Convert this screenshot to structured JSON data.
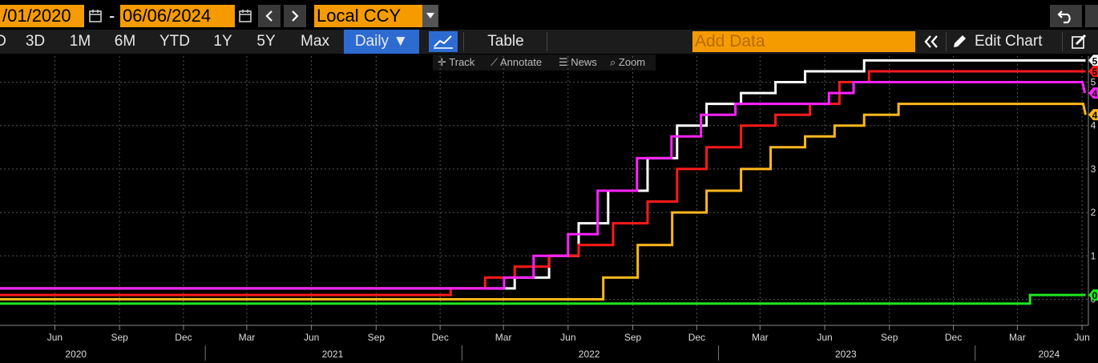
{
  "toolbar": {
    "start_date": "/01/2020",
    "end_date": "06/06/2024",
    "date_sep": "-",
    "currency": "Local CCY",
    "ranges": [
      "D",
      "3D",
      "1M",
      "6M",
      "YTD",
      "1Y",
      "5Y",
      "Max"
    ],
    "frequency": "Daily ▼",
    "table_label": "Table",
    "add_data_placeholder": "Add Data",
    "edit_chart_label": "Edit Chart",
    "undo_icon": "undo-icon"
  },
  "chart_tools": {
    "track": "Track",
    "annotate": "Annotate",
    "news": "News",
    "zoom": "Zoom"
  },
  "chart_data": {
    "type": "line",
    "x_axis": {
      "range": [
        "2020-03-15",
        "2024-06-10"
      ],
      "month_ticks": [
        {
          "date": "2020-06-01",
          "label": "Jun"
        },
        {
          "date": "2020-09-01",
          "label": "Sep"
        },
        {
          "date": "2020-12-01",
          "label": "Dec"
        },
        {
          "date": "2021-03-01",
          "label": "Mar"
        },
        {
          "date": "2021-06-01",
          "label": "Jun"
        },
        {
          "date": "2021-09-01",
          "label": "Sep"
        },
        {
          "date": "2021-12-01",
          "label": "Dec"
        },
        {
          "date": "2022-03-01",
          "label": "Mar"
        },
        {
          "date": "2022-06-01",
          "label": "Jun"
        },
        {
          "date": "2022-09-01",
          "label": "Sep"
        },
        {
          "date": "2022-12-01",
          "label": "Dec"
        },
        {
          "date": "2023-03-01",
          "label": "Mar"
        },
        {
          "date": "2023-06-01",
          "label": "Jun"
        },
        {
          "date": "2023-09-01",
          "label": "Sep"
        },
        {
          "date": "2023-12-01",
          "label": "Dec"
        },
        {
          "date": "2024-03-01",
          "label": "Mar"
        },
        {
          "date": "2024-06-01",
          "label": "Jun"
        }
      ],
      "year_labels": [
        {
          "date": "2020-07-01",
          "label": "2020"
        },
        {
          "date": "2021-07-01",
          "label": "2021"
        },
        {
          "date": "2022-07-01",
          "label": "2022"
        },
        {
          "date": "2023-07-01",
          "label": "2023"
        },
        {
          "date": "2024-04-15",
          "label": "2024"
        }
      ],
      "year_dividers": [
        "2021-01-01",
        "2022-01-01",
        "2023-01-01",
        "2024-01-01"
      ]
    },
    "y_axis": {
      "range": [
        -0.6,
        5.6
      ],
      "ticks": [
        {
          "value": 0,
          "label": "0"
        },
        {
          "value": 1,
          "label": "1"
        },
        {
          "value": 2,
          "label": "2"
        },
        {
          "value": 3,
          "label": "3"
        },
        {
          "value": 4,
          "label": "4"
        },
        {
          "value": 5,
          "label": "5"
        }
      ]
    },
    "grid": true,
    "series": [
      {
        "color": "#ffffff",
        "end_label": "5",
        "points": [
          [
            "2020-03-15",
            0.25
          ],
          [
            "2022-03-17",
            0.5
          ],
          [
            "2022-05-05",
            1.0
          ],
          [
            "2022-06-16",
            1.75
          ],
          [
            "2022-07-28",
            2.5
          ],
          [
            "2022-09-22",
            3.25
          ],
          [
            "2022-11-03",
            4.0
          ],
          [
            "2022-12-15",
            4.5
          ],
          [
            "2023-02-02",
            4.75
          ],
          [
            "2023-03-23",
            5.0
          ],
          [
            "2023-05-04",
            5.25
          ],
          [
            "2023-07-27",
            5.5
          ],
          [
            "2024-06-06",
            5.5
          ]
        ]
      },
      {
        "color": "#ff1a1a",
        "end_label": "5",
        "points": [
          [
            "2020-03-15",
            0.1
          ],
          [
            "2021-12-16",
            0.25
          ],
          [
            "2022-02-03",
            0.5
          ],
          [
            "2022-03-17",
            0.75
          ],
          [
            "2022-05-05",
            1.0
          ],
          [
            "2022-06-16",
            1.25
          ],
          [
            "2022-08-04",
            1.75
          ],
          [
            "2022-09-22",
            2.25
          ],
          [
            "2022-11-03",
            3.0
          ],
          [
            "2022-12-15",
            3.5
          ],
          [
            "2023-02-02",
            4.0
          ],
          [
            "2023-03-23",
            4.25
          ],
          [
            "2023-05-11",
            4.5
          ],
          [
            "2023-06-22",
            5.0
          ],
          [
            "2023-08-03",
            5.25
          ],
          [
            "2024-06-06",
            5.25
          ]
        ]
      },
      {
        "color": "#ff22ff",
        "end_label": "4",
        "points": [
          [
            "2020-03-15",
            0.25
          ],
          [
            "2022-03-02",
            0.5
          ],
          [
            "2022-04-13",
            1.0
          ],
          [
            "2022-06-01",
            1.5
          ],
          [
            "2022-07-13",
            2.5
          ],
          [
            "2022-09-07",
            3.25
          ],
          [
            "2022-10-26",
            3.75
          ],
          [
            "2022-12-07",
            4.25
          ],
          [
            "2023-01-25",
            4.5
          ],
          [
            "2023-06-07",
            4.75
          ],
          [
            "2023-07-12",
            5.0
          ],
          [
            "2024-06-05",
            4.75
          ]
        ]
      },
      {
        "color": "#ffb81c",
        "end_label": "4",
        "points": [
          [
            "2020-03-15",
            0.0
          ],
          [
            "2022-07-21",
            0.5
          ],
          [
            "2022-09-08",
            1.25
          ],
          [
            "2022-10-27",
            2.0
          ],
          [
            "2022-12-15",
            2.5
          ],
          [
            "2023-02-02",
            3.0
          ],
          [
            "2023-03-16",
            3.5
          ],
          [
            "2023-05-04",
            3.75
          ],
          [
            "2023-06-15",
            4.0
          ],
          [
            "2023-07-27",
            4.25
          ],
          [
            "2023-09-14",
            4.5
          ],
          [
            "2024-06-06",
            4.25
          ]
        ]
      },
      {
        "color": "#1ee81e",
        "end_label": "0",
        "points": [
          [
            "2020-03-15",
            -0.1
          ],
          [
            "2024-03-19",
            0.1
          ],
          [
            "2024-06-06",
            0.1
          ]
        ]
      }
    ]
  }
}
